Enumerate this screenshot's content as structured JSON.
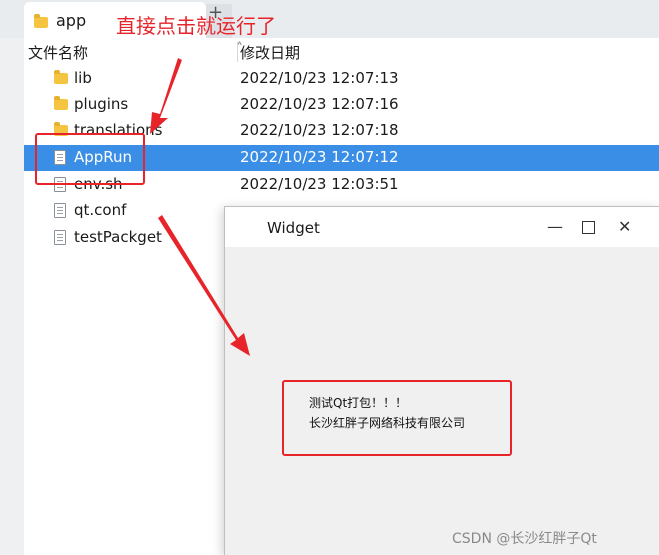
{
  "explorer": {
    "tab_title": "app",
    "new_tab_symbol": "+",
    "columns": {
      "name": "文件名称",
      "modified": "修改日期"
    },
    "rows": [
      {
        "name": "lib",
        "date": "2022/10/23 12:07:13",
        "kind": "folder-icon"
      },
      {
        "name": "plugins",
        "date": "2022/10/23 12:07:16",
        "kind": "folder-icon"
      },
      {
        "name": "translations",
        "date": "2022/10/23 12:07:18",
        "kind": "folder-icon"
      },
      {
        "name": "AppRun",
        "date": "2022/10/23 12:07:12",
        "kind": "file-icon",
        "selected": true
      },
      {
        "name": "env.sh",
        "date": "2022/10/23 12:03:51",
        "kind": "file-icon"
      },
      {
        "name": "qt.conf",
        "date": "",
        "kind": "file-icon"
      },
      {
        "name": "testPackget",
        "date": "",
        "kind": "file-icon"
      }
    ]
  },
  "widget_window": {
    "title": "Widget",
    "minimize_symbol": "—",
    "close_symbol": "✕",
    "label_line1": "测试Qt打包！！！",
    "label_line2": "长沙红胖子网络科技有限公司"
  },
  "annotation": {
    "text": "直接点击就运行了",
    "color": "#e8242b"
  },
  "watermark": "CSDN @长沙红胖子Qt",
  "colors": {
    "selection": "#3a8ee6",
    "folder": "#f5c542"
  }
}
